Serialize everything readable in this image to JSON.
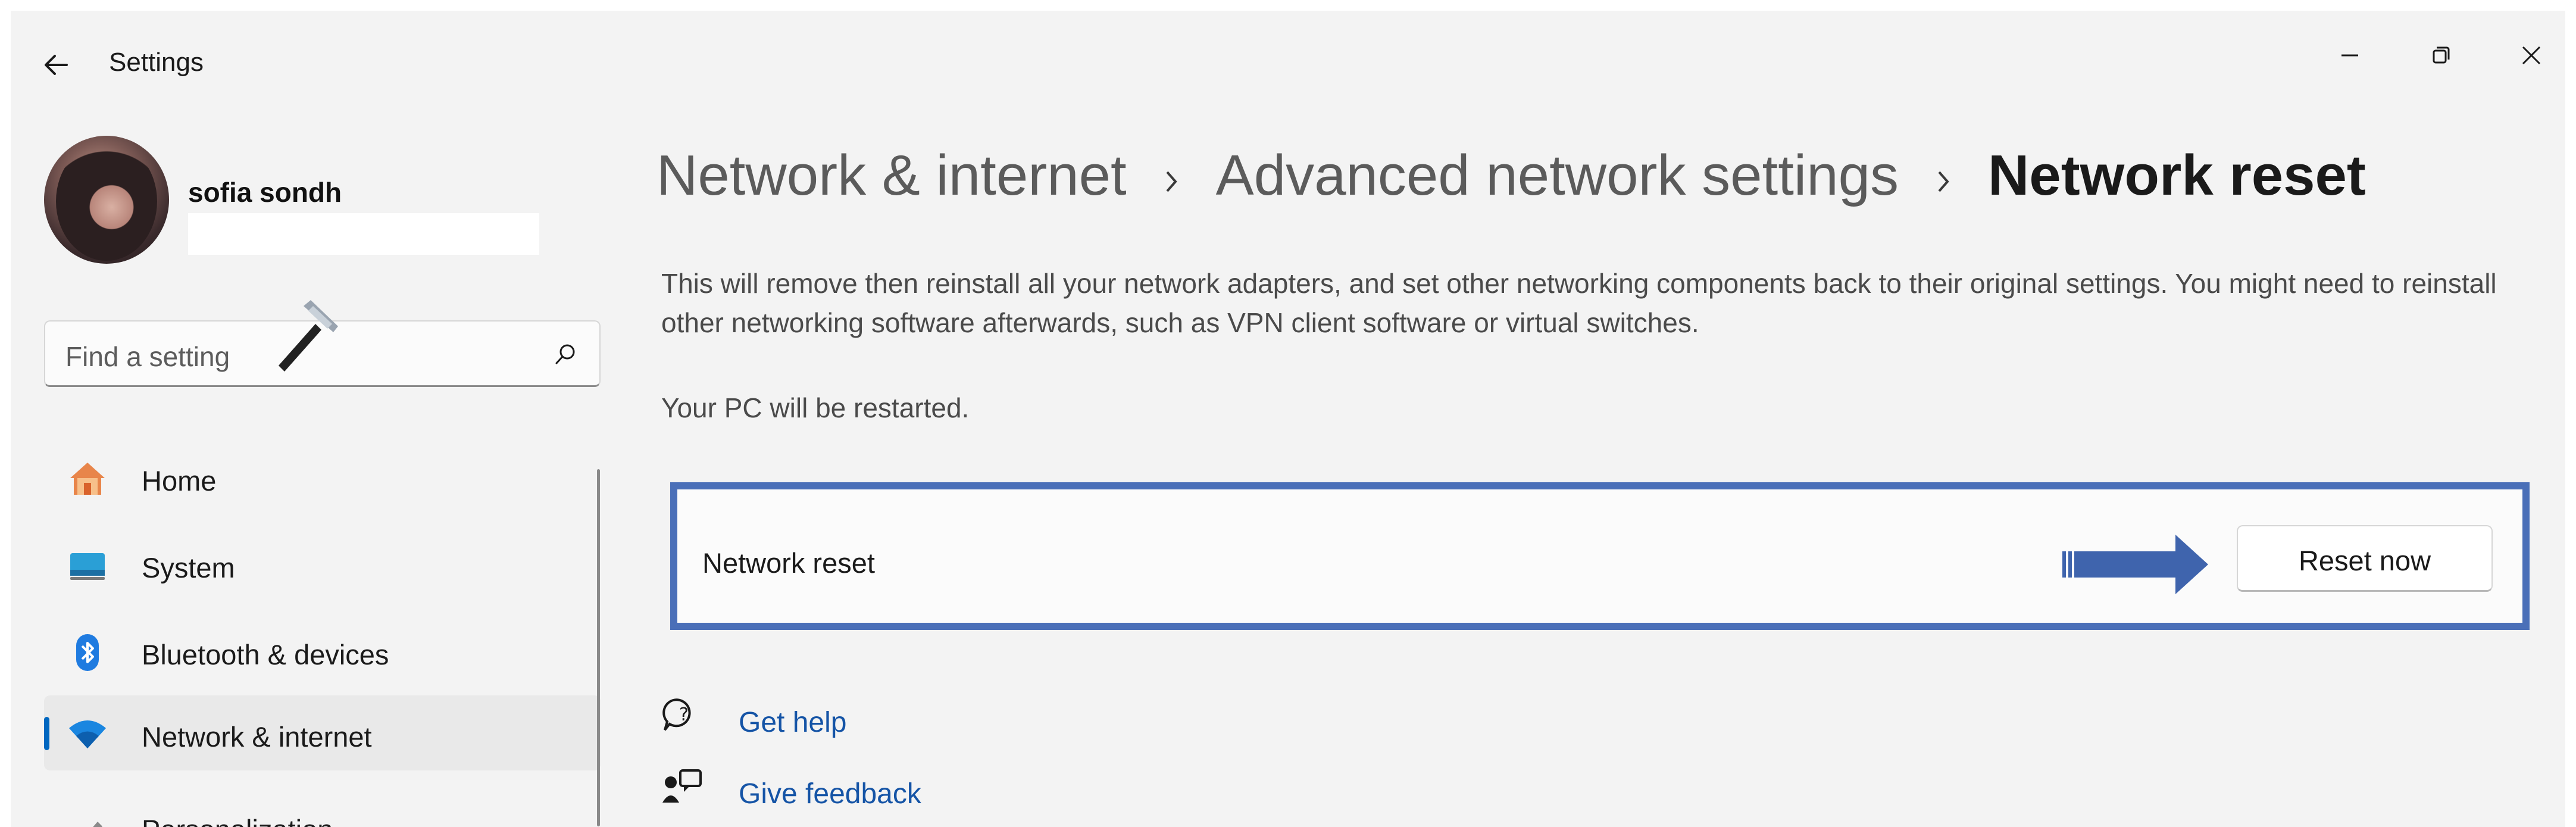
{
  "window": {
    "title": "Settings",
    "controls": [
      "minimize-icon",
      "restore-icon",
      "close-icon"
    ]
  },
  "user": {
    "name": "sofia sondh",
    "email": ""
  },
  "search": {
    "placeholder": "Find a setting",
    "icon": "search-icon"
  },
  "sidebar": {
    "items": [
      {
        "label": "Home",
        "icon": "home-icon"
      },
      {
        "label": "System",
        "icon": "system-display-icon"
      },
      {
        "label": "Bluetooth & devices",
        "icon": "bluetooth-icon"
      },
      {
        "label": "Network & internet",
        "icon": "wifi-icon",
        "active": true
      },
      {
        "label": "Personalization",
        "icon": "brush-icon"
      }
    ]
  },
  "breadcrumb": {
    "level1": "Network & internet",
    "level2": "Advanced network settings",
    "current": "Network reset"
  },
  "content": {
    "description": "This will remove then reinstall all your network adapters, and set other networking components back to their original settings. You might need to reinstall other networking software afterwards, such as VPN client software or virtual switches.",
    "restart_note": "Your PC will be restarted.",
    "card_label": "Network reset",
    "reset_button": "Reset now",
    "get_help": "Get help",
    "give_feedback": "Give feedback"
  },
  "colors": {
    "accent": "#0067c0",
    "highlight_border": "#4a6fb8",
    "link": "#1554a6",
    "background": "#f3f3f3"
  }
}
